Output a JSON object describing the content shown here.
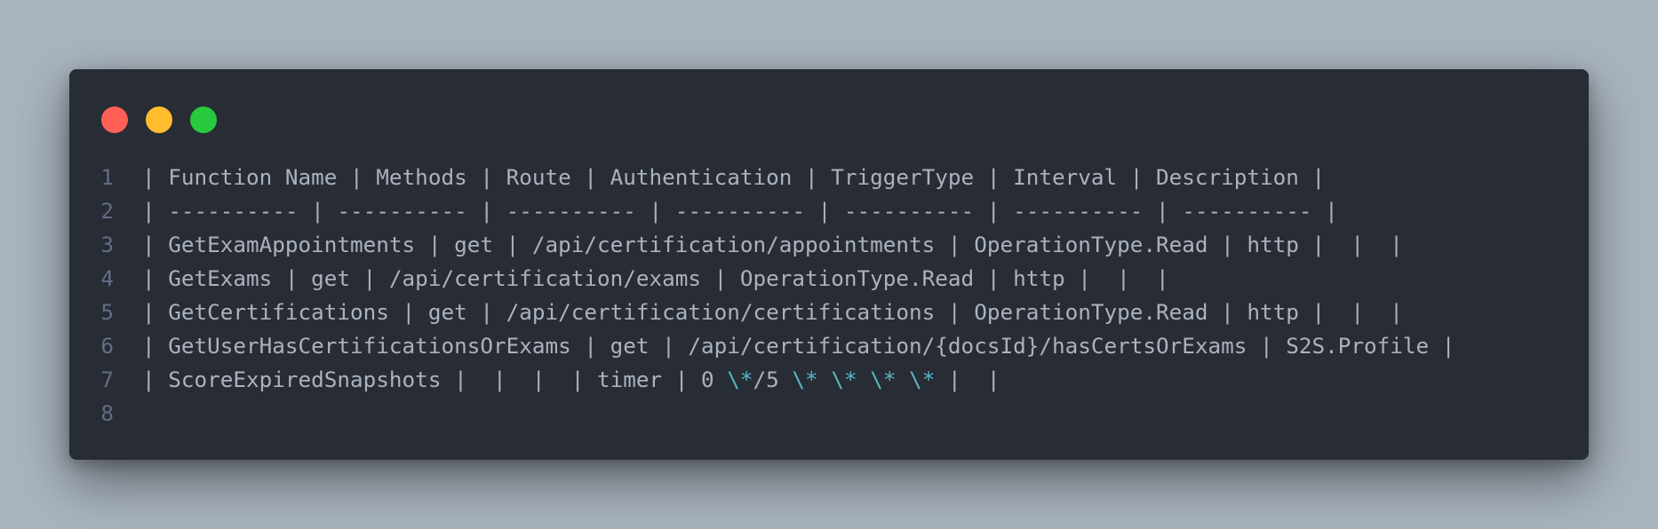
{
  "window": {
    "controls": {
      "close_color": "#ff5f56",
      "minimize_color": "#ffbd2e",
      "maximize_color": "#27c93f"
    }
  },
  "code": {
    "lines": [
      {
        "number": "1",
        "text": "| Function Name | Methods | Route | Authentication | TriggerType | Interval | Description |"
      },
      {
        "number": "2",
        "text": "| ---------- | ---------- | ---------- | ---------- | ---------- | ---------- | ---------- |"
      },
      {
        "number": "3",
        "text": "| GetExamAppointments | get | /api/certification/appointments | OperationType.Read | http |  |  |"
      },
      {
        "number": "4",
        "text": "| GetExams | get | /api/certification/exams | OperationType.Read | http |  |  |"
      },
      {
        "number": "5",
        "text": "| GetCertifications | get | /api/certification/certifications | OperationType.Read | http |  |  |"
      },
      {
        "number": "6",
        "text": "| GetUserHasCertificationsOrExams | get | /api/certification/{docsId}/hasCertsOrExams | S2S.Profile |"
      },
      {
        "number": "7",
        "parts": [
          {
            "text": "| ScoreExpiredSnapshots |  |  |  | timer | 0 ",
            "type": "plain"
          },
          {
            "text": "\\*",
            "type": "escape"
          },
          {
            "text": "/5 ",
            "type": "plain"
          },
          {
            "text": "\\*",
            "type": "escape"
          },
          {
            "text": " ",
            "type": "plain"
          },
          {
            "text": "\\*",
            "type": "escape"
          },
          {
            "text": " ",
            "type": "plain"
          },
          {
            "text": "\\*",
            "type": "escape"
          },
          {
            "text": " ",
            "type": "plain"
          },
          {
            "text": "\\*",
            "type": "escape"
          },
          {
            "text": " |  |",
            "type": "plain"
          }
        ]
      },
      {
        "number": "8",
        "text": ""
      }
    ]
  }
}
